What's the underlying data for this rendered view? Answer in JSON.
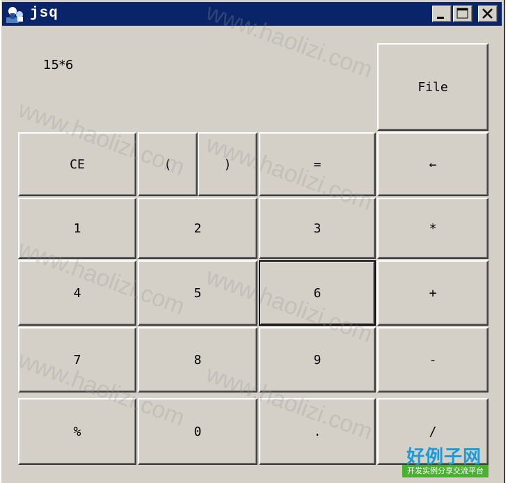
{
  "window": {
    "title": "jsq",
    "icon": "java-app-icon"
  },
  "display": {
    "expression": "15*6"
  },
  "buttons": {
    "file": "File",
    "ce": "CE",
    "lparen": "(",
    "rparen": ")",
    "equals": "=",
    "backspace": "←",
    "d1": "1",
    "d2": "2",
    "d3": "3",
    "mul": "*",
    "d4": "4",
    "d5": "5",
    "d6": "6",
    "add": "+",
    "d7": "7",
    "d8": "8",
    "d9": "9",
    "sub": "-",
    "percent": "%",
    "d0": "0",
    "dot": ".",
    "div": "/"
  },
  "watermark": {
    "text": "www.haolizi.com"
  },
  "logo": {
    "main": "好例子网",
    "sub": "开发实例分享交流平台"
  },
  "colors": {
    "title_bar": "#0a246a",
    "face": "#d4d0c8",
    "logo_blue": "#1a9ad6",
    "logo_green": "#4ab030"
  }
}
